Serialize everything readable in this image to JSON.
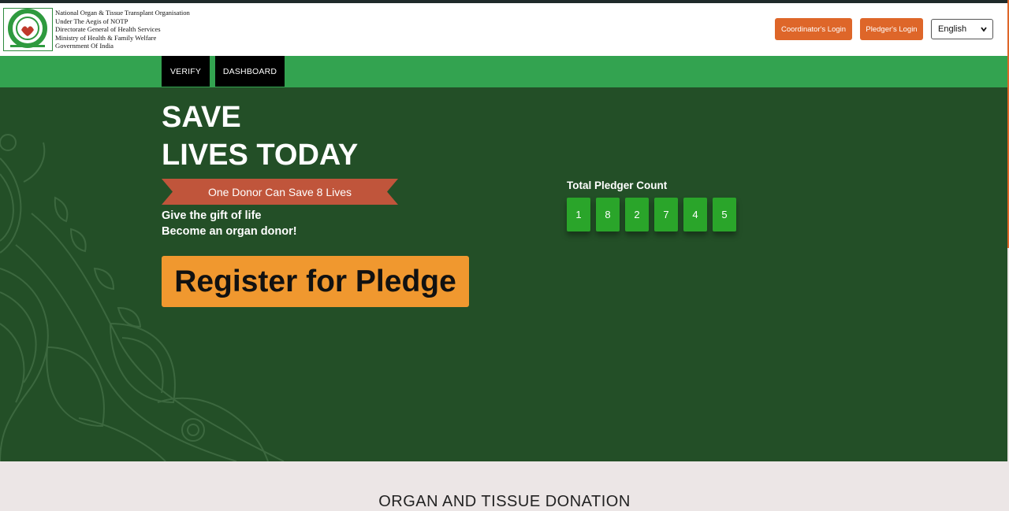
{
  "header": {
    "org_lines": [
      "National Organ & Tissue Transplant Organisation",
      "Under The Aegis of NOTP",
      "Directorate General of Health Services",
      "Ministry of Health & Family Welfare",
      "Government Of India"
    ],
    "coordinator_login": "Coordinator's Login",
    "pledger_login": "Pledger's Login",
    "language": "English"
  },
  "nav": {
    "items": [
      "VERIFY",
      "DASHBOARD"
    ]
  },
  "hero": {
    "headline_line1": "SAVE",
    "headline_line2": "LIVES TODAY",
    "ribbon": "One Donor Can Save 8 Lives",
    "tagline_line1": "Give the gift of life",
    "tagline_line2": "Become an organ donor!",
    "register_button": "Register for Pledge",
    "counter_label": "Total Pledger Count",
    "counter_digits": [
      "1",
      "8",
      "2",
      "7",
      "4",
      "5"
    ]
  },
  "section": {
    "title": "ORGAN AND TISSUE DONATION"
  },
  "colors": {
    "nav_green": "#33a350",
    "hero_green": "#234f27",
    "orange_button": "#de6629",
    "register_orange": "#f0982f",
    "ribbon_red": "#c0553b",
    "digit_green": "#2aa52a"
  },
  "icons": {
    "logo": "notto-logo-icon",
    "select_chevron": "chevron-down-icon"
  }
}
